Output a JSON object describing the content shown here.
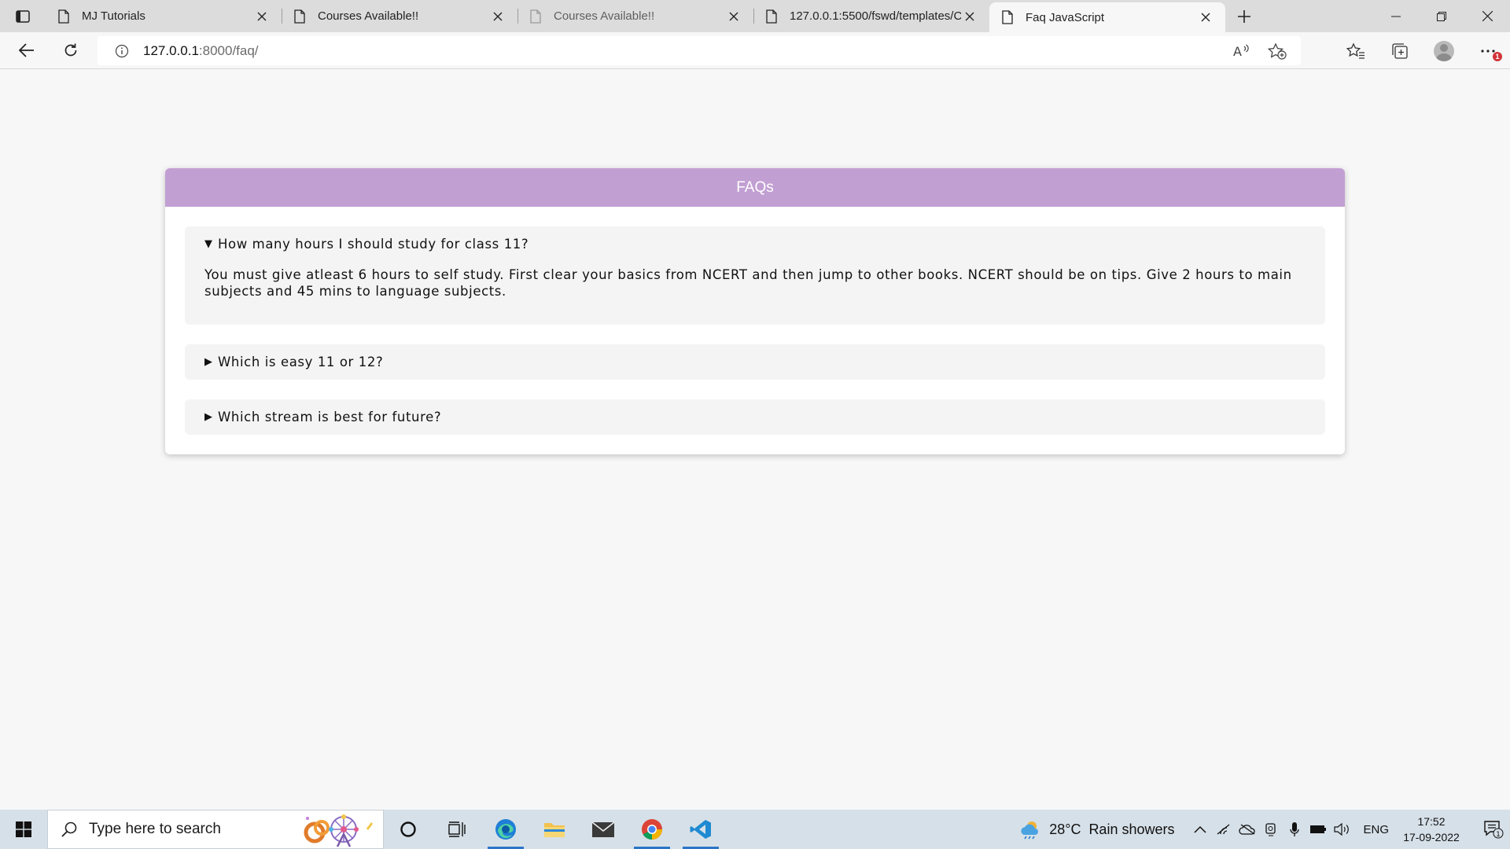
{
  "browser": {
    "tabs": [
      {
        "title": "MJ Tutorials",
        "active": false,
        "faded": false
      },
      {
        "title": "Courses Available!!",
        "active": false,
        "faded": false
      },
      {
        "title": "Courses Available!!",
        "active": false,
        "faded": true
      },
      {
        "title": "127.0.0.1:5500/fswd/templates/C",
        "active": false,
        "faded": false
      },
      {
        "title": "Faq JavaScript",
        "active": true,
        "faded": false
      }
    ],
    "address": {
      "host": "127.0.0.1",
      "path": ":8000/faq/"
    }
  },
  "page": {
    "header": "FAQs",
    "accent_color": "#c29fd3",
    "faqs": [
      {
        "question": "How many hours I should study for class 11?",
        "open": true,
        "answer": "You must give atleast 6 hours to self study. First clear your basics from NCERT and then jump to other books. NCERT should be on tips. Give 2 hours to main subjects and 45 mins to language subjects."
      },
      {
        "question": "Which is easy 11 or 12?",
        "open": false
      },
      {
        "question": "Which stream is best for future?",
        "open": false
      }
    ]
  },
  "taskbar": {
    "search_placeholder": "Type here to search",
    "weather": {
      "temp": "28°C",
      "condition": "Rain showers"
    },
    "language": "ENG",
    "time": "17:52",
    "date": "17-09-2022",
    "notification_count": "1",
    "edge_badge": "1"
  },
  "icons": {
    "triangle_open": "▼",
    "triangle_closed": "▶"
  }
}
